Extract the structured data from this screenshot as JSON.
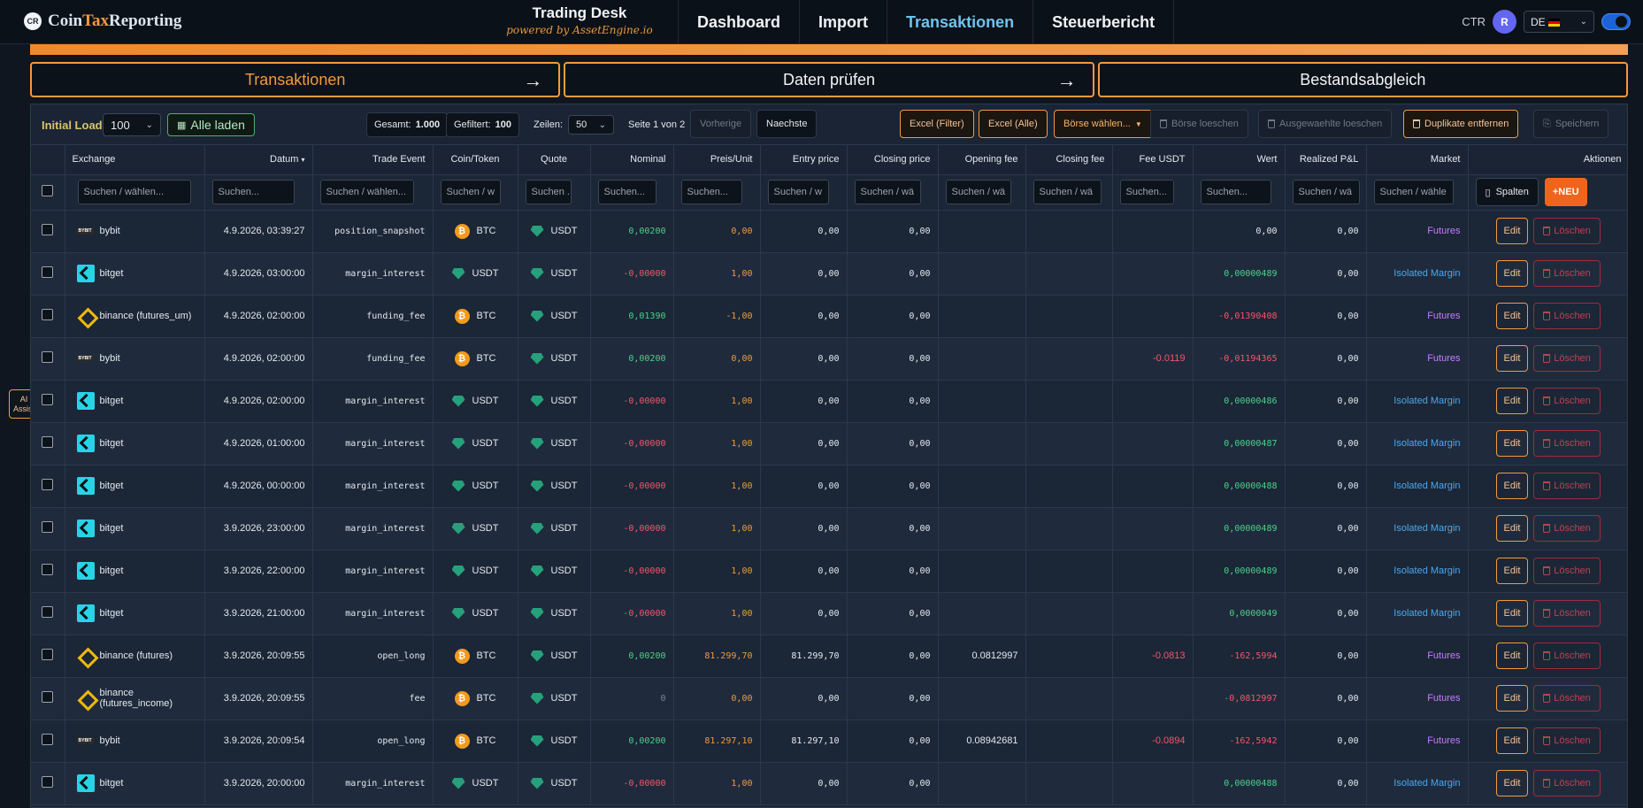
{
  "app": {
    "logo_mark": "CR",
    "logo_prefix": "Coin",
    "logo_mid": "Tax",
    "logo_suffix": "Reporting",
    "brand_title": "Trading Desk",
    "brand_sub": "powered by AssetEngine.io"
  },
  "nav": {
    "items": [
      {
        "label": "Dashboard"
      },
      {
        "label": "Import"
      },
      {
        "label": "Transaktionen",
        "active": true
      },
      {
        "label": "Steuerbericht"
      }
    ]
  },
  "user": {
    "ctr": "CTR",
    "avatar": "R",
    "lang": "DE",
    "toggle_on": true
  },
  "steps": [
    {
      "label": "Transaktionen",
      "arrow": "→"
    },
    {
      "label": "Daten prüfen",
      "arrow": "→"
    },
    {
      "label": "Bestandsabgleich",
      "arrow": ""
    }
  ],
  "ai_assist": {
    "line1": "AI",
    "line2": "Assist"
  },
  "toolbar": {
    "initial_load_label": "Initial Load:",
    "initial_load_value": "100",
    "alle_laden": "Alle laden",
    "gesamt_label": "Gesamt:",
    "gesamt_value": "1.000",
    "gefiltert_label": "Gefiltert:",
    "gefiltert_value": "100",
    "zeilen_label": "Zeilen:",
    "zeilen_value": "50",
    "seite": "Seite 1 von 2",
    "vorherige": "Vorherige",
    "naechste": "Naechste",
    "excel_filter": "Excel (Filter)",
    "excel_alle": "Excel (Alle)",
    "boerse_waehlen": "Börse wählen...",
    "boerse_loeschen": "Börse loeschen",
    "ausgewaehlte_loeschen": "Ausgewaehlte loeschen",
    "duplikate": "Duplikate entfernen",
    "speichern": "Speichern"
  },
  "table": {
    "headers": [
      "Exchange",
      "Datum",
      "Trade Event",
      "Coin/Token",
      "Quote",
      "Nominal",
      "Preis/Unit",
      "Entry price",
      "Closing price",
      "Opening fee",
      "Closing fee",
      "Fee USDT",
      "Wert",
      "Realized P&L",
      "Market",
      "Aktionen"
    ],
    "sort_indicator": "▾",
    "filters": [
      "Suchen / wählen...",
      "Suchen...",
      "Suchen / wählen...",
      "Suchen / w",
      "Suchen .",
      "Suchen...",
      "Suchen...",
      "Suchen / w",
      "Suchen / wä",
      "Suchen / wä",
      "Suchen / wä",
      "Suchen...",
      "Suchen...",
      "Suchen / wä",
      "Suchen / wähle"
    ],
    "spalten": "Spalten",
    "neu": "+NEU",
    "edit": "Edit",
    "loeschen": "Löschen",
    "rows": [
      {
        "exchange": "bybit",
        "ex_type": "bybit",
        "datum": "4.9.2026, 03:39:27",
        "event": "position_snapshot",
        "coin": "BTC",
        "quote": "USDT",
        "nominal": "0,00200",
        "nominal_c": "green",
        "preis": "0,00",
        "preis_c": "orange",
        "entry": "0,00",
        "closing": "0,00",
        "opening_fee": "",
        "closing_fee": "",
        "fee_usdt": "",
        "wert": "0,00",
        "wert_c": "",
        "pnl": "0,00",
        "market": "Futures",
        "market_c": "purple"
      },
      {
        "exchange": "bitget",
        "ex_type": "bitget",
        "datum": "4.9.2026, 03:00:00",
        "event": "margin_interest",
        "coin": "USDT",
        "quote": "USDT",
        "nominal": "-0,00000",
        "nominal_c": "red",
        "preis": "1,00",
        "preis_c": "orange",
        "entry": "0,00",
        "closing": "0,00",
        "opening_fee": "",
        "closing_fee": "",
        "fee_usdt": "",
        "wert": "0,00000489",
        "wert_c": "green",
        "pnl": "0,00",
        "market": "Isolated Margin",
        "market_c": "blue"
      },
      {
        "exchange": "binance (futures_um)",
        "ex_type": "binance",
        "datum": "4.9.2026, 02:00:00",
        "event": "funding_fee",
        "coin": "BTC",
        "quote": "USDT",
        "nominal": "0,01390",
        "nominal_c": "green",
        "preis": "-1,00",
        "preis_c": "orange",
        "entry": "0,00",
        "closing": "0,00",
        "opening_fee": "",
        "closing_fee": "",
        "fee_usdt": "",
        "wert": "-0,01390408",
        "wert_c": "red",
        "pnl": "0,00",
        "market": "Futures",
        "market_c": "purple"
      },
      {
        "exchange": "bybit",
        "ex_type": "bybit",
        "datum": "4.9.2026, 02:00:00",
        "event": "funding_fee",
        "coin": "BTC",
        "quote": "USDT",
        "nominal": "0,00200",
        "nominal_c": "green",
        "preis": "0,00",
        "preis_c": "orange",
        "entry": "0,00",
        "closing": "0,00",
        "opening_fee": "",
        "closing_fee": "",
        "fee_usdt": "-0.0119",
        "wert": "-0,01194365",
        "wert_c": "red",
        "pnl": "0,00",
        "market": "Futures",
        "market_c": "purple"
      },
      {
        "exchange": "bitget",
        "ex_type": "bitget",
        "datum": "4.9.2026, 02:00:00",
        "event": "margin_interest",
        "coin": "USDT",
        "quote": "USDT",
        "nominal": "-0,00000",
        "nominal_c": "red",
        "preis": "1,00",
        "preis_c": "orange",
        "entry": "0,00",
        "closing": "0,00",
        "opening_fee": "",
        "closing_fee": "",
        "fee_usdt": "",
        "wert": "0,00000486",
        "wert_c": "green",
        "pnl": "0,00",
        "market": "Isolated Margin",
        "market_c": "blue"
      },
      {
        "exchange": "bitget",
        "ex_type": "bitget",
        "datum": "4.9.2026, 01:00:00",
        "event": "margin_interest",
        "coin": "USDT",
        "quote": "USDT",
        "nominal": "-0,00000",
        "nominal_c": "red",
        "preis": "1,00",
        "preis_c": "orange",
        "entry": "0,00",
        "closing": "0,00",
        "opening_fee": "",
        "closing_fee": "",
        "fee_usdt": "",
        "wert": "0,00000487",
        "wert_c": "green",
        "pnl": "0,00",
        "market": "Isolated Margin",
        "market_c": "blue"
      },
      {
        "exchange": "bitget",
        "ex_type": "bitget",
        "datum": "4.9.2026, 00:00:00",
        "event": "margin_interest",
        "coin": "USDT",
        "quote": "USDT",
        "nominal": "-0,00000",
        "nominal_c": "red",
        "preis": "1,00",
        "preis_c": "orange",
        "entry": "0,00",
        "closing": "0,00",
        "opening_fee": "",
        "closing_fee": "",
        "fee_usdt": "",
        "wert": "0,00000488",
        "wert_c": "green",
        "pnl": "0,00",
        "market": "Isolated Margin",
        "market_c": "blue"
      },
      {
        "exchange": "bitget",
        "ex_type": "bitget",
        "datum": "3.9.2026, 23:00:00",
        "event": "margin_interest",
        "coin": "USDT",
        "quote": "USDT",
        "nominal": "-0,00000",
        "nominal_c": "red",
        "preis": "1,00",
        "preis_c": "orange",
        "entry": "0,00",
        "closing": "0,00",
        "opening_fee": "",
        "closing_fee": "",
        "fee_usdt": "",
        "wert": "0,00000489",
        "wert_c": "green",
        "pnl": "0,00",
        "market": "Isolated Margin",
        "market_c": "blue"
      },
      {
        "exchange": "bitget",
        "ex_type": "bitget",
        "datum": "3.9.2026, 22:00:00",
        "event": "margin_interest",
        "coin": "USDT",
        "quote": "USDT",
        "nominal": "-0,00000",
        "nominal_c": "red",
        "preis": "1,00",
        "preis_c": "orange",
        "entry": "0,00",
        "closing": "0,00",
        "opening_fee": "",
        "closing_fee": "",
        "fee_usdt": "",
        "wert": "0,00000489",
        "wert_c": "green",
        "pnl": "0,00",
        "market": "Isolated Margin",
        "market_c": "blue"
      },
      {
        "exchange": "bitget",
        "ex_type": "bitget",
        "datum": "3.9.2026, 21:00:00",
        "event": "margin_interest",
        "coin": "USDT",
        "quote": "USDT",
        "nominal": "-0,00000",
        "nominal_c": "red",
        "preis": "1,00",
        "preis_c": "orange",
        "entry": "0,00",
        "closing": "0,00",
        "opening_fee": "",
        "closing_fee": "",
        "fee_usdt": "",
        "wert": "0,0000049",
        "wert_c": "green",
        "pnl": "0,00",
        "market": "Isolated Margin",
        "market_c": "blue"
      },
      {
        "exchange": "binance (futures)",
        "ex_type": "binance",
        "datum": "3.9.2026, 20:09:55",
        "event": "open_long",
        "coin": "BTC",
        "quote": "USDT",
        "nominal": "0,00200",
        "nominal_c": "green",
        "preis": "81.299,70",
        "preis_c": "orange",
        "entry": "81.299,70",
        "closing": "0,00",
        "opening_fee": "0.0812997",
        "closing_fee": "",
        "fee_usdt": "-0.0813",
        "wert": "-162,5994",
        "wert_c": "red",
        "pnl": "0,00",
        "market": "Futures",
        "market_c": "purple"
      },
      {
        "exchange": "binance (futures_income)",
        "ex_type": "binance",
        "datum": "3.9.2026, 20:09:55",
        "event": "fee",
        "coin": "BTC",
        "quote": "USDT",
        "nominal": "0",
        "nominal_c": "grey",
        "preis": "0,00",
        "preis_c": "orange",
        "entry": "0,00",
        "closing": "0,00",
        "opening_fee": "",
        "closing_fee": "",
        "fee_usdt": "",
        "wert": "-0,0812997",
        "wert_c": "red",
        "pnl": "0,00",
        "market": "Futures",
        "market_c": "purple"
      },
      {
        "exchange": "bybit",
        "ex_type": "bybit",
        "datum": "3.9.2026, 20:09:54",
        "event": "open_long",
        "coin": "BTC",
        "quote": "USDT",
        "nominal": "0,00200",
        "nominal_c": "green",
        "preis": "81.297,10",
        "preis_c": "orange",
        "entry": "81.297,10",
        "closing": "0,00",
        "opening_fee": "0.08942681",
        "closing_fee": "",
        "fee_usdt": "-0.0894",
        "wert": "-162,5942",
        "wert_c": "red",
        "pnl": "0,00",
        "market": "Futures",
        "market_c": "purple"
      },
      {
        "exchange": "bitget",
        "ex_type": "bitget",
        "datum": "3.9.2026, 20:00:00",
        "event": "margin_interest",
        "coin": "USDT",
        "quote": "USDT",
        "nominal": "-0,00000",
        "nominal_c": "red",
        "preis": "1,00",
        "preis_c": "orange",
        "entry": "0,00",
        "closing": "0,00",
        "opening_fee": "",
        "closing_fee": "",
        "fee_usdt": "",
        "wert": "0,00000488",
        "wert_c": "green",
        "pnl": "0,00",
        "market": "Isolated Margin",
        "market_c": "blue"
      }
    ]
  }
}
